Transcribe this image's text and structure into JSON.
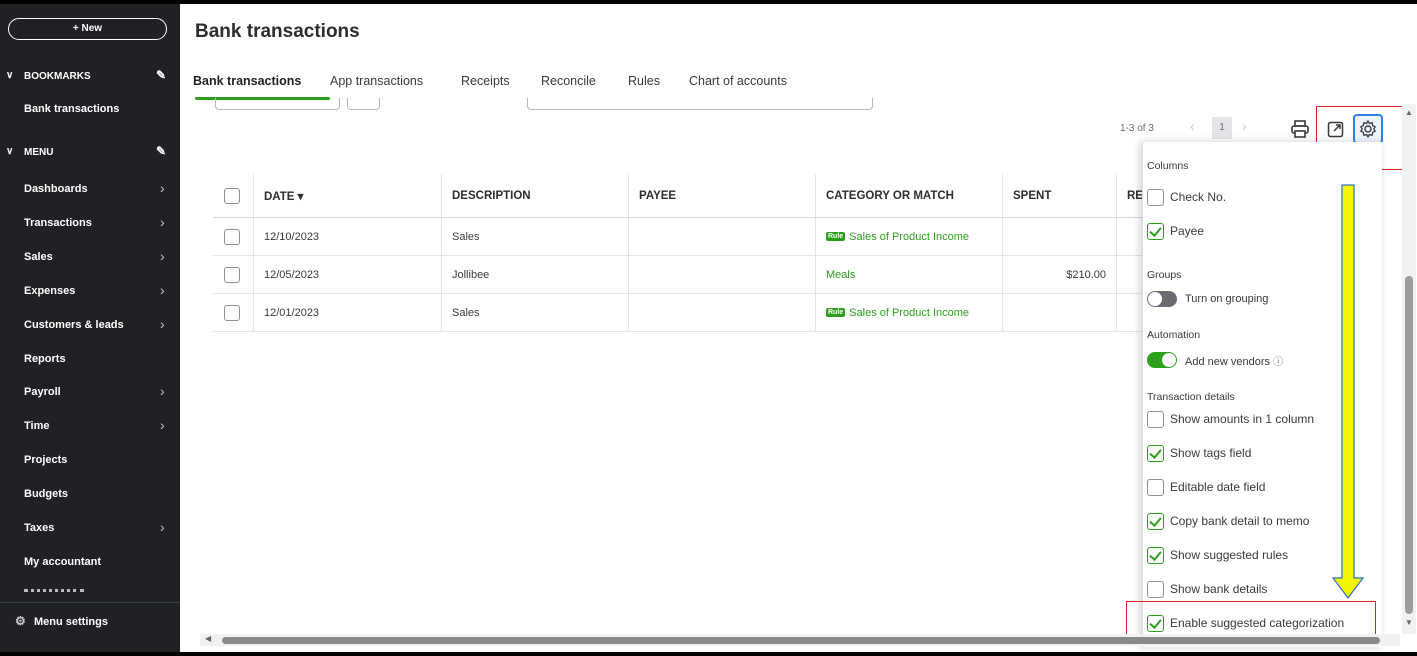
{
  "sidebar": {
    "new_label": "+ New",
    "bookmarks_label": "BOOKMARKS",
    "bookmarks": [
      "Bank transactions"
    ],
    "menu_label": "MENU",
    "items": [
      {
        "label": "Dashboards",
        "arrow": true
      },
      {
        "label": "Transactions",
        "arrow": true
      },
      {
        "label": "Sales",
        "arrow": true
      },
      {
        "label": "Expenses",
        "arrow": true
      },
      {
        "label": "Customers & leads",
        "arrow": true
      },
      {
        "label": "Reports",
        "arrow": false
      },
      {
        "label": "Payroll",
        "arrow": true
      },
      {
        "label": "Time",
        "arrow": true
      },
      {
        "label": "Projects",
        "arrow": false
      },
      {
        "label": "Budgets",
        "arrow": false
      },
      {
        "label": "Taxes",
        "arrow": true
      },
      {
        "label": "My accountant",
        "arrow": false
      }
    ],
    "menu_settings": "Menu settings"
  },
  "page": {
    "title": "Bank transactions"
  },
  "tabs": [
    "Bank transactions",
    "App transactions",
    "Receipts",
    "Reconcile",
    "Rules",
    "Chart of accounts"
  ],
  "pagination": {
    "range": "1-3 of 3",
    "current_page": "1",
    "prev": "‹",
    "next": "›"
  },
  "table": {
    "headers": {
      "date": "DATE ▾",
      "description": "DESCRIPTION",
      "payee": "PAYEE",
      "category": "CATEGORY OR MATCH",
      "spent": "SPENT",
      "received": "RE"
    },
    "rows": [
      {
        "date": "12/10/2023",
        "description": "Sales",
        "payee": "",
        "rule": "Rule",
        "category": "Sales of Product Income",
        "spent": ""
      },
      {
        "date": "12/05/2023",
        "description": "Jollibee",
        "payee": "",
        "rule": "",
        "category": "Meals",
        "spent": "$210.00"
      },
      {
        "date": "12/01/2023",
        "description": "Sales",
        "payee": "",
        "rule": "Rule",
        "category": "Sales of Product Income",
        "spent": ""
      }
    ]
  },
  "settings_panel": {
    "columns_heading": "Columns",
    "check_no": "Check No.",
    "payee": "Payee",
    "groups_heading": "Groups",
    "grouping_toggle": "Turn on grouping",
    "automation_heading": "Automation",
    "vendors_toggle": "Add new vendors",
    "info_icon": "ⓘ",
    "details_heading": "Transaction details",
    "show_amounts": "Show amounts in 1 column",
    "show_tags": "Show tags field",
    "editable_date": "Editable date field",
    "copy_detail": "Copy bank detail to memo",
    "suggested_rules": "Show suggested rules",
    "bank_details": "Show bank details",
    "suggested_categorization": "Enable suggested categorization",
    "states": {
      "check_no": false,
      "payee": true,
      "grouping": false,
      "vendors": true,
      "show_amounts": false,
      "show_tags": true,
      "editable_date": false,
      "copy_detail": true,
      "suggested_rules": true,
      "bank_details": false,
      "suggested_categorization": true
    }
  },
  "icons": {
    "new": "plus-icon",
    "edit": "pencil-icon",
    "print": "print-icon",
    "export": "export-icon",
    "settings": "gear-icon"
  },
  "colors": {
    "sidebar_bg": "#1f2124",
    "accent_green": "#2ca01c",
    "highlight_red": "#e02020",
    "gear_blue": "#2f80ed",
    "annotation_arrow": "#f5f500"
  }
}
